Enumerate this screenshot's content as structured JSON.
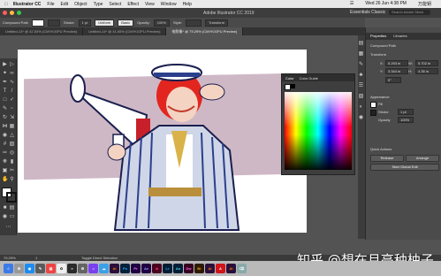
{
  "menubar": {
    "app": "Illustrator CC",
    "items": [
      "File",
      "Edit",
      "Object",
      "Type",
      "Select",
      "Effect",
      "View",
      "Window",
      "Help"
    ],
    "datetime": "Wed 26 Jun 4:38 PM",
    "user": "万能钥"
  },
  "window": {
    "title": "Adobe Illustrator CC 2019",
    "workspace": "Essentials Classic",
    "search_placeholder": "Search Adobe Stock"
  },
  "controlbar": {
    "selection_type": "Compound Path",
    "stroke_label": "Stroke:",
    "stroke_value": "1 pt",
    "uniform": "Uniform",
    "basic": "Basic",
    "opacity_label": "Opacity:",
    "opacity_value": "100%",
    "style_label": "Style:",
    "transform": "Transform"
  },
  "tabs": [
    "Untitled-13* @ 42.54% (CMYK/GPU Preview)",
    "Untitled-14* @ 41.65% (CMYK/GPU Preview)",
    "电鲜像* @ 79.29% (CMYK/GPU Preview)"
  ],
  "color_panel": {
    "tab_color": "Color",
    "tab_guide": "Color Guide"
  },
  "right_panel": {
    "tab_properties": "Properties",
    "tab_libraries": "Libraries",
    "compound_path": "Compound Path",
    "transform": "Transform",
    "x_label": "X:",
    "x_value": "5.293 in",
    "y_label": "Y:",
    "y_value": "3.344 in",
    "w_label": "W:",
    "w_value": "5.702 in",
    "h_label": "H:",
    "h_value": "4.35 in",
    "angle_value": "0°",
    "appearance": "Appearance",
    "fill": "Fill",
    "stroke": "Stroke",
    "stroke_value": "1 pt",
    "opacity": "Opacity",
    "opacity_value": "100%",
    "quick_actions": "Quick Actions",
    "release": "Release",
    "arrange": "Arrange",
    "start_global_edit": "Start Global Edit"
  },
  "status": {
    "zoom": "79.29%",
    "tool": "Toggle Direct Selection",
    "page": "1"
  },
  "dock": [
    "Ai",
    "Ps",
    "Pr",
    "Ae",
    "Id",
    "Lr",
    "An",
    "Dw",
    "Br",
    "Ai",
    "A",
    "Ai"
  ],
  "watermark": "知乎 @想在月亮种柚子",
  "colors": {
    "accent": "#ff7c00",
    "pink_band": "#cfb8c6",
    "hair": "#e2261f"
  }
}
